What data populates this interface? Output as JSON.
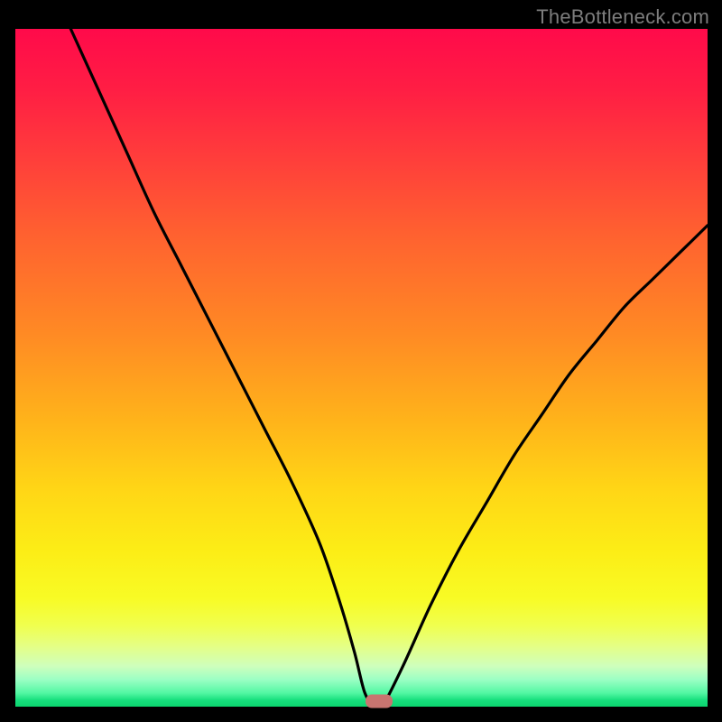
{
  "watermark": "TheBottleneck.com",
  "colors": {
    "frame": "#000000",
    "curve": "#000000",
    "marker": "#c87470",
    "gradient_top": "#ff0a4a",
    "gradient_bottom": "#0bd46e"
  },
  "chart_data": {
    "type": "line",
    "title": "",
    "xlabel": "",
    "ylabel": "",
    "xlim": [
      0,
      100
    ],
    "ylim": [
      0,
      100
    ],
    "x": [
      8,
      12,
      16,
      20,
      24,
      28,
      32,
      36,
      40,
      44,
      47,
      49,
      50.5,
      52,
      53,
      56,
      60,
      64,
      68,
      72,
      76,
      80,
      84,
      88,
      92,
      96,
      100
    ],
    "values": [
      100,
      91,
      82,
      73,
      65,
      57,
      49,
      41,
      33,
      24,
      15,
      8,
      2,
      0,
      0,
      6,
      15,
      23,
      30,
      37,
      43,
      49,
      54,
      59,
      63,
      67,
      71
    ],
    "marker": {
      "x": 52.5,
      "y": 0
    },
    "note": "No axis ticks or numeric labels are visible in the image; x and y values above are normalized 0–100 estimates of the curve position within the plot area."
  }
}
